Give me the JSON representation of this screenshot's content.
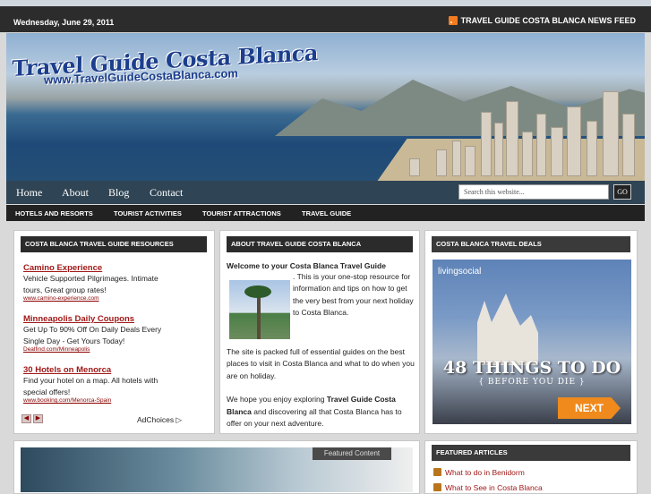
{
  "topbar": {
    "date": "Wednesday, June 29, 2011",
    "feed": "TRAVEL GUIDE COSTA BLANCA NEWS FEED"
  },
  "header": {
    "logo_title": "Travel Guide Costa Blanca",
    "logo_url": "www.TravelGuideCostaBlanca.com"
  },
  "nav": {
    "items": [
      "Home",
      "About",
      "Blog",
      "Contact"
    ],
    "search_placeholder": "Search this website...",
    "go": "GO"
  },
  "subnav": {
    "items": [
      "HOTELS AND RESORTS",
      "TOURIST ACTIVITIES",
      "TOURIST ATTRACTIONS",
      "TRAVEL GUIDE"
    ]
  },
  "resources": {
    "title": "COSTA BLANCA TRAVEL GUIDE RESOURCES",
    "ads": [
      {
        "title": "Camino Experience",
        "desc": "Vehicle Supported Pilgrimages. Intimate tours, Great group rates!",
        "url": "www.camino-experience.com"
      },
      {
        "title": "Minneapolis Daily Coupons",
        "desc": "Get Up To 90% Off On Daily Deals Every Single Day - Get Yours Today!",
        "url": "Dealfind.com/Minneapolis"
      },
      {
        "title": "30 Hotels on Menorca",
        "desc": "Find your hotel on a map. All hotels with special offers!",
        "url": "www.booking.com/Menorca-Spain"
      }
    ],
    "adchoices": "AdChoices"
  },
  "about": {
    "title": "ABOUT TRAVEL GUIDE COSTA BLANCA",
    "welcome": "Welcome to your Costa Blanca Travel Guide",
    "p1": ". This is your one-stop resource for information and tips on how to get the very best from your next holiday to Costa Blanca.",
    "p2": "The site is packed full of essential guides on the best places to visit in Costa Blanca and what to do when you are on holiday.",
    "p3a": "We hope you enjoy exploring ",
    "p3b": "Travel Guide Costa Blanca",
    "p3c": " and discovering all that Costa Blanca has to offer on your next adventure."
  },
  "deals": {
    "title": "COSTA BLANCA TRAVEL DEALS",
    "brand": "livingsocial",
    "headline": "48 THINGS TO DO",
    "sub": "{ BEFORE YOU DIE }",
    "button": "NEXT"
  },
  "featured_content": {
    "label": "Featured Content"
  },
  "featured_articles": {
    "title": "FEATURED ARTICLES",
    "items": [
      "What to do in Benidorm",
      "What to See in Costa Blanca"
    ]
  }
}
